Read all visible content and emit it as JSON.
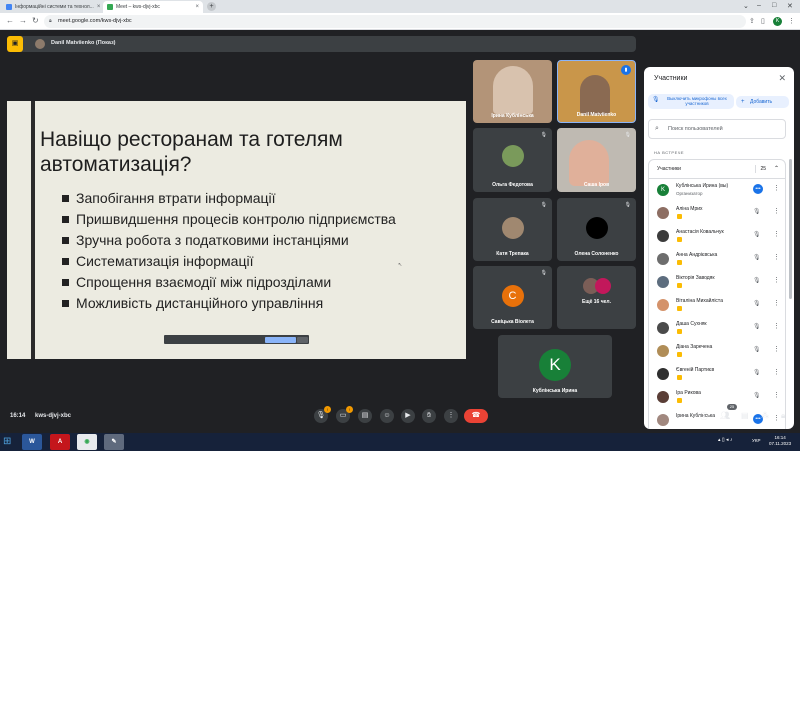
{
  "browser": {
    "tabs": [
      {
        "title": "Інформаційні системи та технол...",
        "favicon_color": "#4285f4"
      },
      {
        "title": "Meet – kws-djvj-xbc",
        "favicon_color": "#34a853"
      }
    ],
    "new_tab": "+",
    "url": "meet.google.com/kws-djvj-xbc",
    "profile_initial": "K"
  },
  "meet": {
    "presenter_name": "Danil Matviienko (Показ)",
    "slide": {
      "title": "Навіщо ресторанам та готелям автоматизація?",
      "bullets": [
        "Запобігання втрати інформації",
        "Пришвидшення процесів контролю підприємства",
        "Зручна робота з податковими інстанціями",
        "Систематизація інформації",
        "Спрощення взаємодії між підрозділами",
        "Можливість дистанційного управління"
      ]
    },
    "tiles": [
      {
        "name": "Ірина Кублінська"
      },
      {
        "name": "Danil Matviienko"
      },
      {
        "name": "Ольга Федотова"
      },
      {
        "name": "Саша Іров"
      },
      {
        "name": "Катя Трепака"
      },
      {
        "name": "Олена Солоненко"
      },
      {
        "name": "Савіцька Віолета",
        "initial": "С",
        "color": "#e8710a"
      },
      {
        "name": "Ещё 16 чел."
      },
      {
        "name": "Кублінська Ирина",
        "initial": "K",
        "color": "#188038"
      }
    ],
    "clock": "16:14",
    "meeting_code": "kws-djvj-xbc",
    "people_count": "25"
  },
  "people_panel": {
    "title": "Участники",
    "mute_all_label": "Выключить микрофоны всех участников",
    "add_label": "Добавить",
    "search_placeholder": "Поиск пользователей",
    "section_label": "НА ВСТРЕЧЕ",
    "group_label": "Участники",
    "group_count": "25",
    "participants": [
      {
        "name": "Кублінська Ирина (вы)",
        "role": "Организатор",
        "initial": "K",
        "color": "#188038"
      },
      {
        "name": "Аліна Мрих",
        "color": "#8d6e63"
      },
      {
        "name": "Анастасія Ковальчук",
        "color": "#3c3c3c"
      },
      {
        "name": "Анна Андрієвська",
        "color": "#6d6d6d"
      },
      {
        "name": "Вікторія Заводяк",
        "color": "#5d6d7e"
      },
      {
        "name": "Віталіна Михайлістa",
        "color": "#d4926a"
      },
      {
        "name": "Даша Сухняк",
        "color": "#4a4a4a"
      },
      {
        "name": "Діана Заречена",
        "color": "#b08d57"
      },
      {
        "name": "Євгеній Партиєв",
        "color": "#2f2f2f"
      },
      {
        "name": "Іра Рикова",
        "color": "#5a3e36"
      },
      {
        "name": "Ірина Кублінська",
        "color": "#a1887f"
      }
    ]
  },
  "taskbar": {
    "language": "УКР",
    "time": "16:14",
    "date": "07.11.2023"
  }
}
